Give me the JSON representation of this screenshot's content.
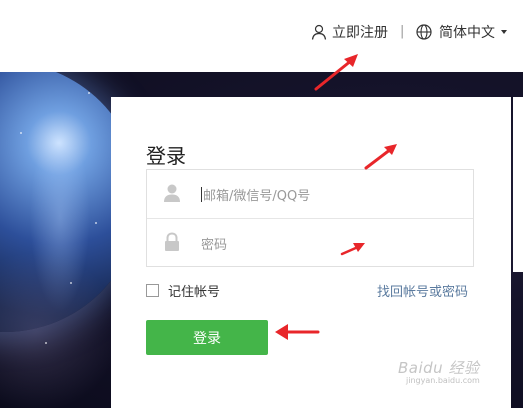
{
  "header": {
    "register_label": "立即注册",
    "separator": "|",
    "language_label": "简体中文"
  },
  "login": {
    "title": "登录",
    "username_placeholder": "邮箱/微信号/QQ号",
    "password_placeholder": "密码",
    "remember_label": "记住帐号",
    "forgot_label": "找回帐号或密码",
    "submit_label": "登录"
  },
  "watermark": {
    "text": "Baidu 经验",
    "url": "jingyan.baidu.com"
  },
  "colors": {
    "primary_button": "#44b549",
    "link": "#5b7b9f",
    "annotation_arrow": "#e8262a"
  },
  "icons": [
    "user-icon",
    "globe-icon",
    "lock-icon",
    "caret-down-icon"
  ]
}
